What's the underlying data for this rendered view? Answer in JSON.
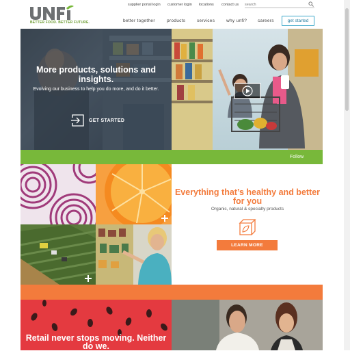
{
  "utility": {
    "links": [
      "supplier portal login",
      "customer login",
      "locations",
      "contact us"
    ],
    "search_placeholder": "search"
  },
  "brand": {
    "logo_text": "UNFI",
    "tagline": "BETTER FOOD. BETTER FUTURE.",
    "colors": {
      "green": "#78b83a",
      "orange": "#f37b3c",
      "blue": "#3aa7c9"
    }
  },
  "nav": {
    "items": [
      "better together",
      "products",
      "services",
      "why unfi?",
      "careers"
    ],
    "cta": "get started"
  },
  "hero": {
    "title": "More products, solutions and insights.",
    "subtitle": "Evolving our business to help you do more, and do it better.",
    "cta": "GET STARTED"
  },
  "follow": {
    "label": "Follow"
  },
  "healthy": {
    "heading": "Everything that’s healthy and better for you",
    "subheading": "Organic, natural & specialty products",
    "button": "LEARN MORE"
  },
  "retail": {
    "heading": "Retail never stops moving. Neither do we."
  }
}
